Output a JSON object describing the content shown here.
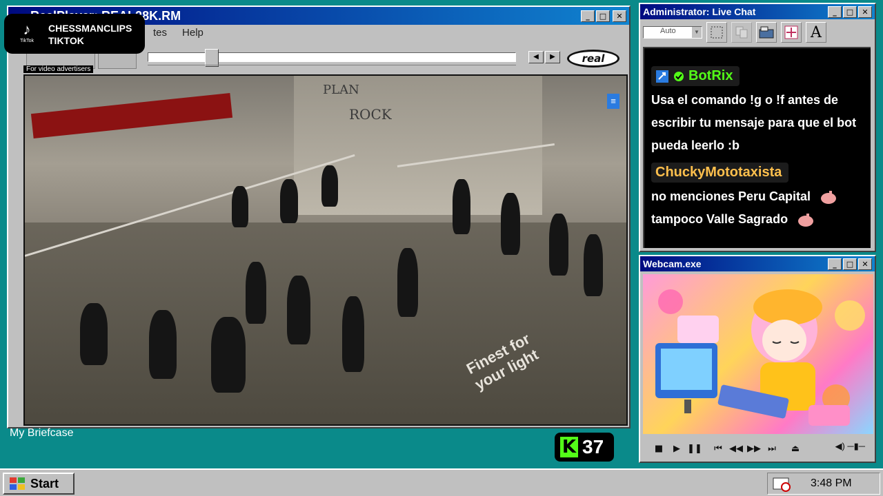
{
  "player": {
    "title": "RealPlayer: REAL28K.RM",
    "menu": [
      "tes",
      "Help"
    ],
    "seek_position": 0.16,
    "logo_text": "real",
    "ad_label": "For video advertisers",
    "video_wall_text": [
      "PLAN",
      "ROCK"
    ],
    "video_floor_text": "Finest for your light"
  },
  "tiktok": {
    "logo_label": "TikTok",
    "line1": "CHESSMANCLIPS",
    "line2": "TIKTOK"
  },
  "chat": {
    "title": "Administrator: Live Chat",
    "zoom": "Auto",
    "messages": [
      {
        "user": "BotRix",
        "user_color": "#53fc18",
        "text": "Usa el comando !g o !f antes de escribir tu mensaje para que el bot pueda leerlo :b"
      },
      {
        "user": "ChuckyMototaxista",
        "user_color": "#ffc04d",
        "lines": [
          "no menciones Peru Capital",
          "tampoco Valle Sagrado"
        ]
      }
    ]
  },
  "webcam": {
    "title": "Webcam.exe"
  },
  "desktop": {
    "briefcase_label": "My Briefcase"
  },
  "kick": {
    "logo": "K",
    "count": "37"
  },
  "taskbar": {
    "start_label": "Start",
    "clock": "3:48 PM"
  },
  "colors": {
    "desktop": "#0a8a8a",
    "titlebar": "#000a80",
    "kick_green": "#53fc18"
  }
}
